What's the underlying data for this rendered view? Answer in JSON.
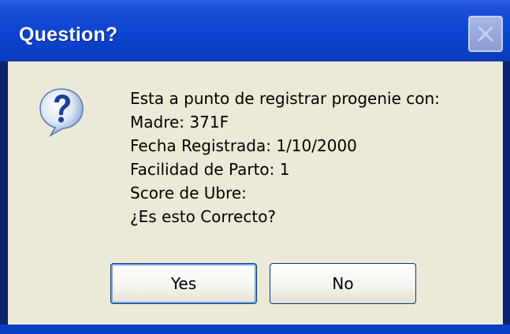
{
  "window": {
    "title": "Question?"
  },
  "dialog": {
    "icon": "question-icon",
    "message_lines": [
      "Esta a punto de registrar progenie con:",
      "Madre: 371F",
      "Fecha Registrada: 1/10/2000",
      "Facilidad de Parto: 1",
      "Score de Ubre:",
      "¿Es esto Correcto?"
    ]
  },
  "buttons": {
    "yes_label": "Yes",
    "no_label": "No"
  },
  "colors": {
    "titlebar": "#0b45d3",
    "client": "#ece9d8",
    "button_border": "#003c74"
  }
}
